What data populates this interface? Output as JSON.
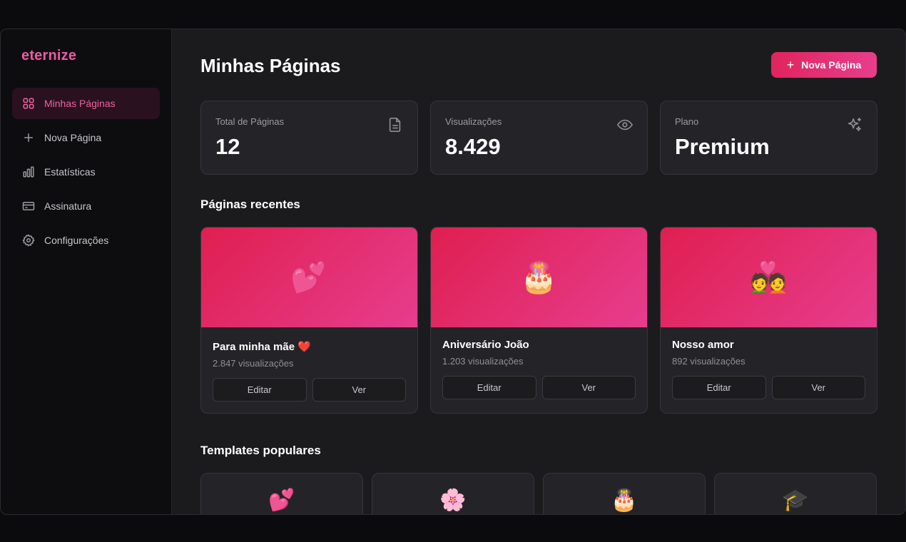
{
  "brand": {
    "name": "eternize",
    "color": "#ec5aa5"
  },
  "sidebar": {
    "items": [
      {
        "label": "Minhas Páginas",
        "icon": "grid-icon",
        "active": true
      },
      {
        "label": "Nova Página",
        "icon": "plus-icon"
      },
      {
        "label": "Estatísticas",
        "icon": "bar-chart-icon"
      },
      {
        "label": "Assinatura",
        "icon": "credit-card-icon"
      },
      {
        "label": "Configurações",
        "icon": "gear-icon"
      }
    ]
  },
  "header": {
    "title": "Minhas Páginas",
    "new_button": {
      "plus": "+",
      "label": "Nova Página"
    }
  },
  "stats": [
    {
      "label": "Total de Páginas",
      "value": "12",
      "icon": "file-icon"
    },
    {
      "label": "Visualizações",
      "value": "8.429",
      "icon": "eye-icon"
    },
    {
      "label": "Plano",
      "value": "Premium",
      "icon": "sparkles-icon"
    }
  ],
  "recent": {
    "title": "Páginas recentes",
    "cards": [
      {
        "emoji": "💕",
        "title": "Para minha mãe ❤️",
        "views": "2.847 visualizações",
        "edit": "Editar",
        "view": "Ver"
      },
      {
        "emoji": "🎂",
        "title": "Aniversário João",
        "views": "1.203 visualizações",
        "edit": "Editar",
        "view": "Ver"
      },
      {
        "emoji": "💑",
        "title": "Nosso amor",
        "views": "892 visualizações",
        "edit": "Editar",
        "view": "Ver"
      }
    ]
  },
  "templates": {
    "title": "Templates populares",
    "items": [
      {
        "emoji": "💕"
      },
      {
        "emoji": "🌸"
      },
      {
        "emoji": "🎂"
      },
      {
        "emoji": "🎓"
      }
    ]
  },
  "colors": {
    "accent_start": "#e0245e",
    "accent_end": "#e83e8c",
    "active_nav_bg": "#2a1120"
  }
}
